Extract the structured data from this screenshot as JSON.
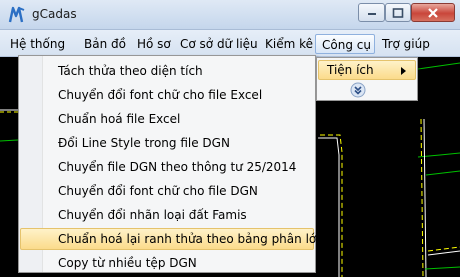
{
  "window": {
    "title": "gCadas"
  },
  "menubar": {
    "items": [
      {
        "label": "Hệ thống"
      },
      {
        "label": "Bản đồ"
      },
      {
        "label": "Hồ sơ"
      },
      {
        "label": "Cơ sở dữ liệu"
      },
      {
        "label": "Kiểm kê"
      },
      {
        "label": "Công cụ"
      },
      {
        "label": "Trợ giúp"
      }
    ]
  },
  "submenu": {
    "label": "Tiện ích"
  },
  "dropdown": {
    "items": [
      {
        "label": "Tách thửa theo diện tích"
      },
      {
        "label": "Chuyển đổi font chữ cho file Excel"
      },
      {
        "label": "Chuẩn hoá file Excel"
      },
      {
        "label": "Đổi Line Style trong file DGN"
      },
      {
        "label": "Chuyển file DGN theo thông tư 25/2014"
      },
      {
        "label": "Chuyển đổi font chữ cho file DGN"
      },
      {
        "label": "Chuyển đổi nhãn loại đất Famis"
      },
      {
        "label": "Chuẩn hoá lại ranh thửa theo bảng phân lớp"
      },
      {
        "label": "Copy từ nhiều tệp DGN"
      }
    ]
  },
  "colors": {
    "canvas_background": "#000000",
    "drawing_line_white": "#ffffff",
    "drawing_line_yellow": "#ffff00",
    "drawing_line_green": "#00c000",
    "highlight": "#fbdb8b"
  }
}
